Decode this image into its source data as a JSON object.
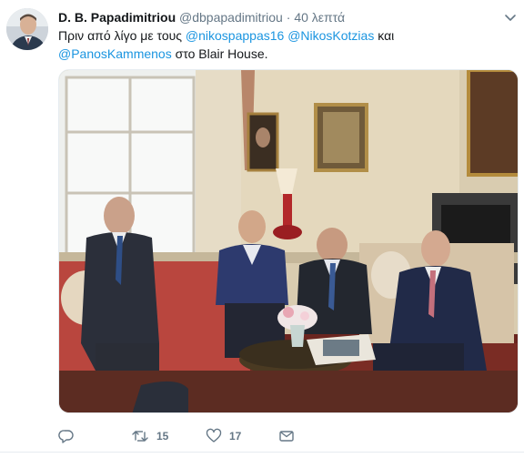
{
  "tweet": {
    "author_name": "D. B. Papadimitriou",
    "author_handle": "@dbpapadimitriou",
    "separator": "·",
    "timestamp": "40 λεπτά",
    "text_prefix": "Πριν από λίγο με τους ",
    "mention_1": "@nikospappas16",
    "mention_2": "@NikosKotzias",
    "text_mid": " και",
    "mention_3": "@PanosKammenos",
    "text_suffix": " στο Blair House."
  },
  "actions": {
    "reply_count": "",
    "retweet_count": "15",
    "like_count": "17"
  },
  "icons": {
    "reply": "reply-icon",
    "retweet": "retweet-icon",
    "like": "heart-icon",
    "message": "envelope-icon",
    "caret": "chevron-down-icon"
  },
  "colors": {
    "link": "#1b95e0",
    "secondary_text": "#657786"
  }
}
